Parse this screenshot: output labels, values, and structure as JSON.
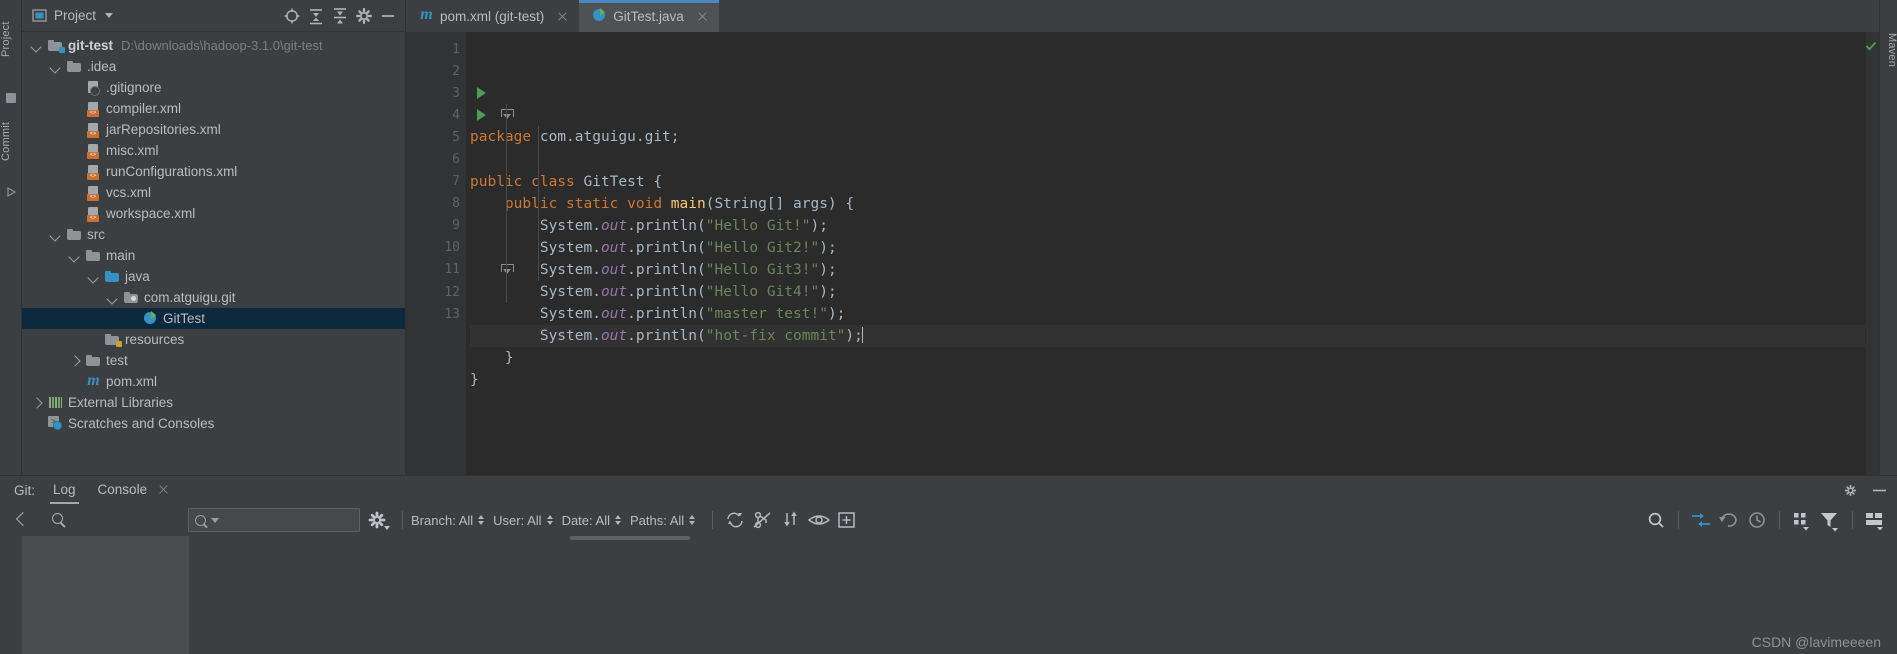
{
  "left_strip": {
    "project_label": "Project",
    "commit_label": "Commit"
  },
  "right_strip": {
    "maven_label": "Maven"
  },
  "project_panel": {
    "title": "Project",
    "header_icons": [
      "target-icon",
      "collapse-all-icon",
      "expand-all-icon",
      "gear-icon",
      "hide-icon"
    ],
    "tree": [
      {
        "label": "git-test",
        "path": "D:\\downloads\\hadoop-3.1.0\\git-test",
        "icon": "folder-module-icon",
        "indent": 0,
        "arrow": "open",
        "bold": true,
        "selected": false
      },
      {
        "label": ".idea",
        "path": "",
        "icon": "folder-icon",
        "indent": 1,
        "arrow": "open",
        "bold": false,
        "selected": false
      },
      {
        "label": ".gitignore",
        "path": "",
        "icon": "gitignore-file-icon",
        "indent": 2,
        "arrow": "none",
        "bold": false,
        "selected": false
      },
      {
        "label": "compiler.xml",
        "path": "",
        "icon": "xml-file-icon",
        "indent": 2,
        "arrow": "none",
        "bold": false,
        "selected": false
      },
      {
        "label": "jarRepositories.xml",
        "path": "",
        "icon": "xml-file-icon",
        "indent": 2,
        "arrow": "none",
        "bold": false,
        "selected": false
      },
      {
        "label": "misc.xml",
        "path": "",
        "icon": "xml-file-icon",
        "indent": 2,
        "arrow": "none",
        "bold": false,
        "selected": false
      },
      {
        "label": "runConfigurations.xml",
        "path": "",
        "icon": "xml-file-icon",
        "indent": 2,
        "arrow": "none",
        "bold": false,
        "selected": false
      },
      {
        "label": "vcs.xml",
        "path": "",
        "icon": "xml-file-icon",
        "indent": 2,
        "arrow": "none",
        "bold": false,
        "selected": false
      },
      {
        "label": "workspace.xml",
        "path": "",
        "icon": "xml-file-icon",
        "indent": 2,
        "arrow": "none",
        "bold": false,
        "selected": false
      },
      {
        "label": "src",
        "path": "",
        "icon": "folder-icon",
        "indent": 1,
        "arrow": "open",
        "bold": false,
        "selected": false
      },
      {
        "label": "main",
        "path": "",
        "icon": "folder-icon",
        "indent": 2,
        "arrow": "open",
        "bold": false,
        "selected": false
      },
      {
        "label": "java",
        "path": "",
        "icon": "folder-source-icon",
        "indent": 3,
        "arrow": "open",
        "bold": false,
        "selected": false
      },
      {
        "label": "com.atguigu.git",
        "path": "",
        "icon": "package-icon",
        "indent": 4,
        "arrow": "open",
        "bold": false,
        "selected": false
      },
      {
        "label": "GitTest",
        "path": "",
        "icon": "java-class-icon",
        "indent": 5,
        "arrow": "none",
        "bold": false,
        "selected": true
      },
      {
        "label": "resources",
        "path": "",
        "icon": "folder-resources-icon",
        "indent": 3,
        "arrow": "none",
        "bold": false,
        "selected": false
      },
      {
        "label": "test",
        "path": "",
        "icon": "folder-icon",
        "indent": 2,
        "arrow": "closed",
        "bold": false,
        "selected": false
      },
      {
        "label": "pom.xml",
        "path": "",
        "icon": "maven-icon",
        "indent": 2,
        "arrow": "none",
        "bold": false,
        "selected": false
      },
      {
        "label": "External Libraries",
        "path": "",
        "icon": "external-libraries-icon",
        "indent": 0,
        "arrow": "closed",
        "bold": false,
        "selected": false
      },
      {
        "label": "Scratches and Consoles",
        "path": "",
        "icon": "scratches-icon",
        "indent": 0,
        "arrow": "none",
        "bold": false,
        "selected": false
      }
    ]
  },
  "editor": {
    "tabs": [
      {
        "label": "pom.xml (git-test)",
        "icon": "maven-icon",
        "active": false,
        "closable": true
      },
      {
        "label": "GitTest.java",
        "icon": "java-class-icon",
        "active": true,
        "closable": true
      }
    ],
    "line_count": 13,
    "current_line": 10,
    "run_markers": [
      3,
      4
    ],
    "fold_markers": [
      4,
      11
    ],
    "inspection_status": "ok-check-icon",
    "lines": [
      {
        "n": 1,
        "tokens": [
          {
            "t": "kw",
            "v": "package"
          },
          {
            "t": "pln",
            "v": " com.atguigu.git;"
          }
        ]
      },
      {
        "n": 2,
        "tokens": []
      },
      {
        "n": 3,
        "tokens": [
          {
            "t": "kw",
            "v": "public "
          },
          {
            "t": "kw",
            "v": "class "
          },
          {
            "t": "cls",
            "v": "GitTest "
          },
          {
            "t": "pln",
            "v": "{"
          }
        ]
      },
      {
        "n": 4,
        "tokens": [
          {
            "t": "pln",
            "v": "    "
          },
          {
            "t": "kw",
            "v": "public static void "
          },
          {
            "t": "mth",
            "v": "main"
          },
          {
            "t": "pln",
            "v": "(String[] args) {"
          }
        ]
      },
      {
        "n": 5,
        "tokens": [
          {
            "t": "pln",
            "v": "        System."
          },
          {
            "t": "stat",
            "v": "out"
          },
          {
            "t": "pln",
            "v": ".println("
          },
          {
            "t": "str",
            "v": "\"Hello Git!\""
          },
          {
            "t": "pln",
            "v": ");"
          }
        ]
      },
      {
        "n": 6,
        "tokens": [
          {
            "t": "pln",
            "v": "        System."
          },
          {
            "t": "stat",
            "v": "out"
          },
          {
            "t": "pln",
            "v": ".println("
          },
          {
            "t": "str",
            "v": "\"Hello Git2!\""
          },
          {
            "t": "pln",
            "v": ");"
          }
        ]
      },
      {
        "n": 7,
        "tokens": [
          {
            "t": "pln",
            "v": "        System."
          },
          {
            "t": "stat",
            "v": "out"
          },
          {
            "t": "pln",
            "v": ".println("
          },
          {
            "t": "str",
            "v": "\"Hello Git3!\""
          },
          {
            "t": "pln",
            "v": ");"
          }
        ]
      },
      {
        "n": 8,
        "tokens": [
          {
            "t": "pln",
            "v": "        System."
          },
          {
            "t": "stat",
            "v": "out"
          },
          {
            "t": "pln",
            "v": ".println("
          },
          {
            "t": "str",
            "v": "\"Hello Git4!\""
          },
          {
            "t": "pln",
            "v": ");"
          }
        ]
      },
      {
        "n": 9,
        "tokens": [
          {
            "t": "pln",
            "v": "        System."
          },
          {
            "t": "stat",
            "v": "out"
          },
          {
            "t": "pln",
            "v": ".println("
          },
          {
            "t": "str",
            "v": "\"master test!\""
          },
          {
            "t": "pln",
            "v": ");"
          }
        ]
      },
      {
        "n": 10,
        "tokens": [
          {
            "t": "pln",
            "v": "        System."
          },
          {
            "t": "stat",
            "v": "out"
          },
          {
            "t": "pln",
            "v": ".println("
          },
          {
            "t": "str",
            "v": "\"hot-fix commit\""
          },
          {
            "t": "pln",
            "v": ");"
          }
        ],
        "caret_at_end": true
      },
      {
        "n": 11,
        "tokens": [
          {
            "t": "pln",
            "v": "    }"
          }
        ]
      },
      {
        "n": 12,
        "tokens": [
          {
            "t": "pln",
            "v": "}"
          }
        ]
      },
      {
        "n": 13,
        "tokens": []
      }
    ]
  },
  "git_window": {
    "title": "Git:",
    "tabs": [
      {
        "label": "Log",
        "active": true,
        "closable": false
      },
      {
        "label": "Console",
        "active": false,
        "closable": true
      }
    ],
    "header_icons": [
      "gear-icon",
      "hide-icon"
    ],
    "toolbar": {
      "back_icon": "back-arrow-icon",
      "search_icon": "search-icon",
      "filter_placeholder": "",
      "filter_search_icon": "search-icon",
      "gear_icon": "gear-icon",
      "filters": [
        {
          "label": "Branch: All"
        },
        {
          "label": "User: All"
        },
        {
          "label": "Date: All"
        },
        {
          "label": "Paths: All"
        }
      ],
      "action_icons": [
        "refresh-icon",
        "hide-branches-icon",
        "intellisort-icon",
        "show-details-icon",
        "expand-icon"
      ],
      "right_icons": [
        "search-icon",
        "collapse-icon",
        "revert-icon",
        "history-icon",
        "layout-icon",
        "filter-icon",
        "columns-icon"
      ]
    }
  },
  "watermark": "CSDN @lavimeeeen"
}
